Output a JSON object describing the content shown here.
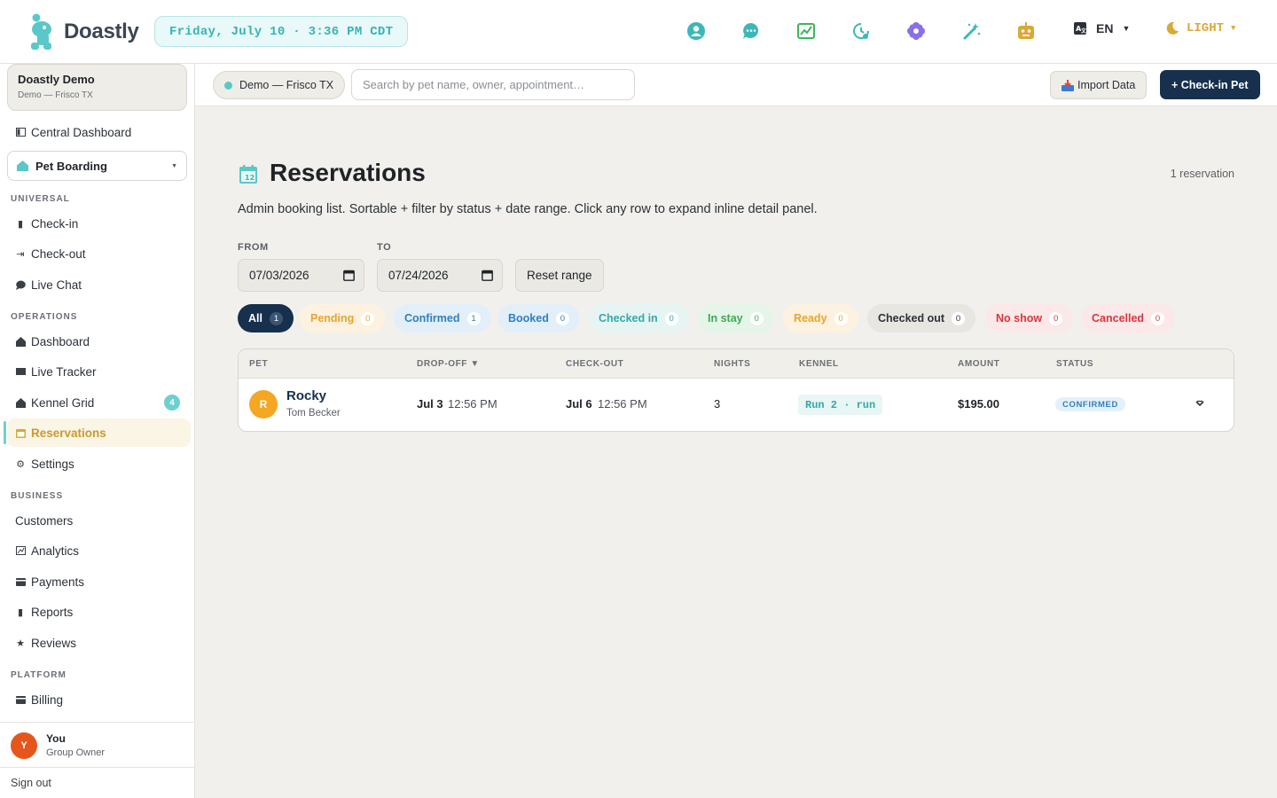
{
  "app": {
    "name": "Doastly",
    "datetime": "Friday, July 10 · 3:36 PM CDT"
  },
  "topbar": {
    "icons": [
      "people-icon",
      "chat-icon",
      "chart-icon",
      "clock-icon",
      "flower-icon",
      "magic-wand-icon",
      "robot-icon"
    ],
    "language": "EN",
    "theme": "LIGHT"
  },
  "sidebar": {
    "org_name": "Doastly Demo",
    "org_location": "Demo — Frisco TX",
    "central_dashboard": "Central Dashboard",
    "module": "Pet Boarding",
    "sections": {
      "universal": "UNIVERSAL",
      "operations": "OPERATIONS",
      "business": "BUSINESS",
      "platform": "PLATFORM"
    },
    "universal": [
      "Check-in",
      "Check-out",
      "Live Chat"
    ],
    "operations": [
      "Dashboard",
      "Live Tracker",
      "Kennel Grid",
      "Reservations",
      "Settings"
    ],
    "kennel_badge": "4",
    "business": [
      "Customers",
      "Analytics",
      "Payments",
      "Reports",
      "Reviews"
    ],
    "platform": [
      "Billing"
    ],
    "user_name": "You",
    "user_initial": "Y",
    "user_role": "Group Owner",
    "sign_out": "Sign out"
  },
  "subheader": {
    "location": "Demo — Frisco TX",
    "search_placeholder": "Search by pet name, owner, appointment…",
    "import_label": "Import Data",
    "checkin_label": "+ Check-in Pet"
  },
  "page": {
    "title": "Reservations",
    "count": "1 reservation",
    "description": "Admin booking list. Sortable + filter by status + date range. Click any row to expand inline detail panel.",
    "from_label": "FROM",
    "to_label": "TO",
    "from_value": "07/03/2026",
    "to_value": "07/24/2026",
    "reset_label": "Reset range"
  },
  "filters": [
    {
      "label": "All",
      "count": "1"
    },
    {
      "label": "Pending",
      "count": "0"
    },
    {
      "label": "Confirmed",
      "count": "1"
    },
    {
      "label": "Booked",
      "count": "0"
    },
    {
      "label": "Checked in",
      "count": "0"
    },
    {
      "label": "In stay",
      "count": "0"
    },
    {
      "label": "Ready",
      "count": "0"
    },
    {
      "label": "Checked out",
      "count": "0"
    },
    {
      "label": "No show",
      "count": "0"
    },
    {
      "label": "Cancelled",
      "count": "0"
    }
  ],
  "table": {
    "headers": {
      "pet": "PET",
      "dropoff": "DROP-OFF ▼",
      "checkout": "CHECK-OUT",
      "nights": "NIGHTS",
      "kennel": "KENNEL",
      "amount": "AMOUNT",
      "status": "STATUS"
    },
    "rows": [
      {
        "initial": "R",
        "pet": "Rocky",
        "owner": "Tom Becker",
        "dropoff_date": "Jul 3",
        "dropoff_time": "12:56 PM",
        "checkout_date": "Jul 6",
        "checkout_time": "12:56 PM",
        "nights": "3",
        "kennel": "Run 2 · run",
        "amount": "$195.00",
        "status": "CONFIRMED"
      }
    ]
  }
}
